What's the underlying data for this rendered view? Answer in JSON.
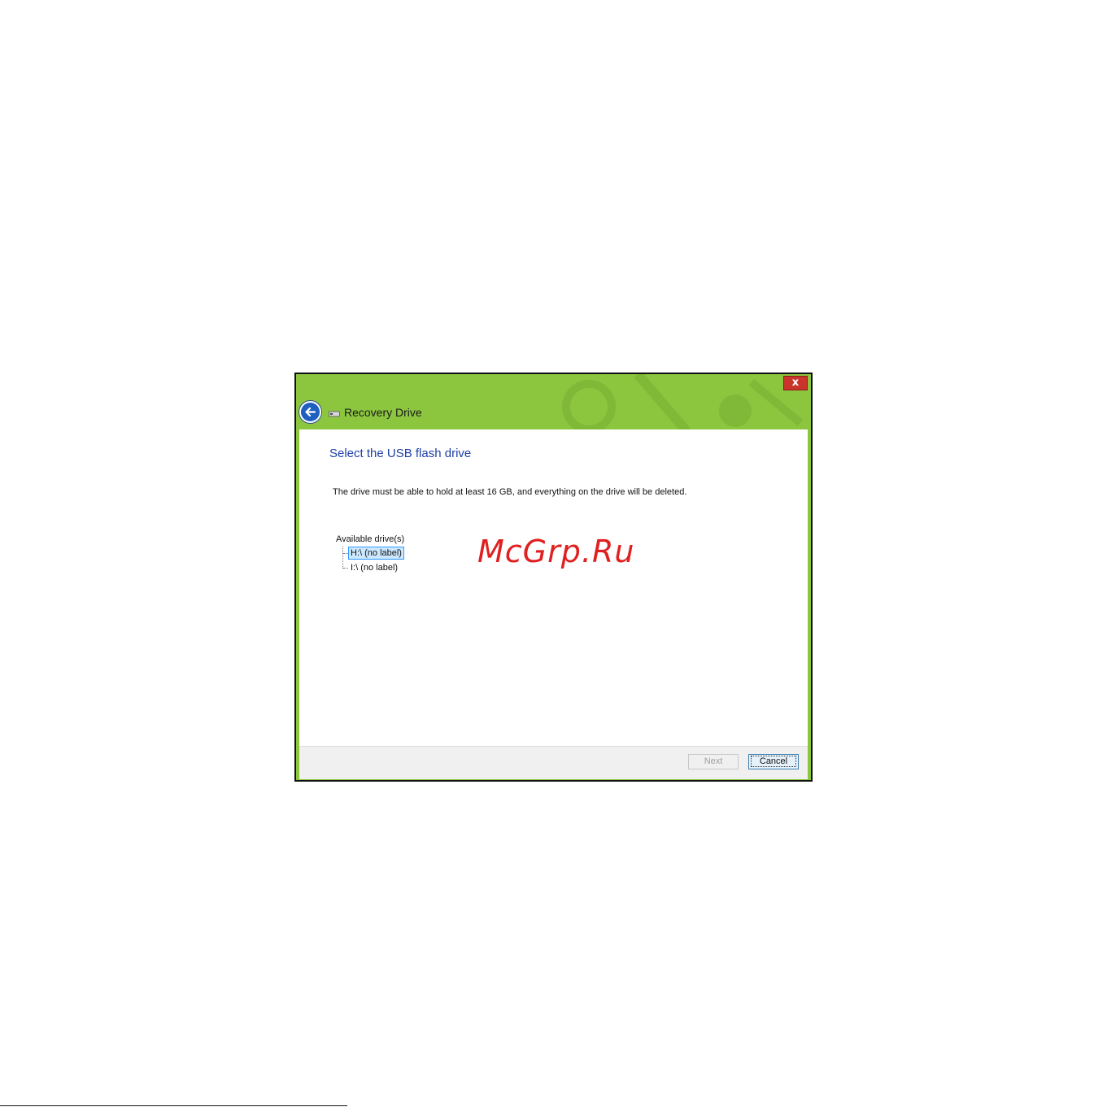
{
  "window": {
    "title": "Recovery Drive",
    "close_label": "x"
  },
  "content": {
    "heading": "Select the USB flash drive",
    "description": "The drive must be able to hold at least 16 GB, and everything on the drive will be deleted.",
    "tree": {
      "label": "Available drive(s)",
      "items": [
        {
          "label": "H:\\ (no label)",
          "selected": true
        },
        {
          "label": "I:\\ (no label)",
          "selected": false
        }
      ]
    }
  },
  "footer": {
    "next_label": "Next",
    "cancel_label": "Cancel"
  },
  "watermark": "McGrp.Ru",
  "colors": {
    "window_frame": "#8cc63f",
    "heading": "#1e3fa8",
    "close": "#c9352b",
    "selection": "#cce8ff"
  }
}
